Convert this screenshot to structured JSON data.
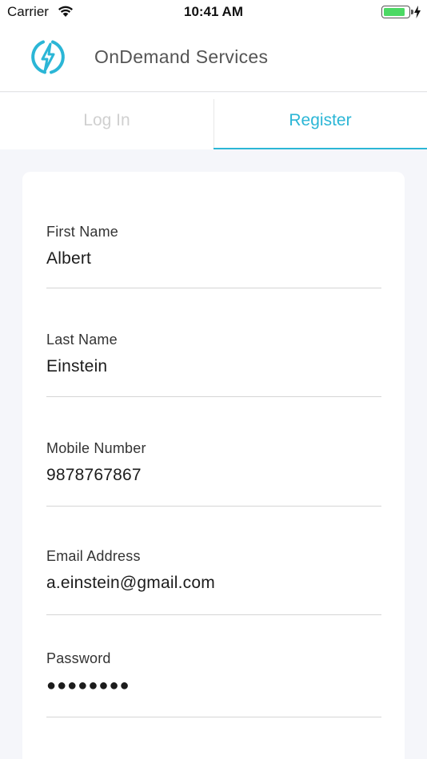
{
  "status_bar": {
    "carrier": "Carrier",
    "time": "10:41 AM",
    "battery_level": 0.85,
    "battery_color": "#4cd964",
    "wifi_icon": "wifi-icon",
    "charging_icon": "charging-bolt-icon"
  },
  "header": {
    "logo_icon": "lightning-bolt-logo",
    "title": "OnDemand Services",
    "accent_color": "#2bb6d6"
  },
  "tabs": [
    {
      "label": "Log In",
      "active": false
    },
    {
      "label": "Register",
      "active": true
    }
  ],
  "form": {
    "fields": [
      {
        "label": "First Name",
        "value": "Albert"
      },
      {
        "label": "Last Name",
        "value": "Einstein"
      },
      {
        "label": "Mobile Number",
        "value": "9878767867"
      },
      {
        "label": "Email Address",
        "value": "a.einstein@gmail.com"
      },
      {
        "label": "Password",
        "value": "●●●●●●●●"
      }
    ]
  }
}
